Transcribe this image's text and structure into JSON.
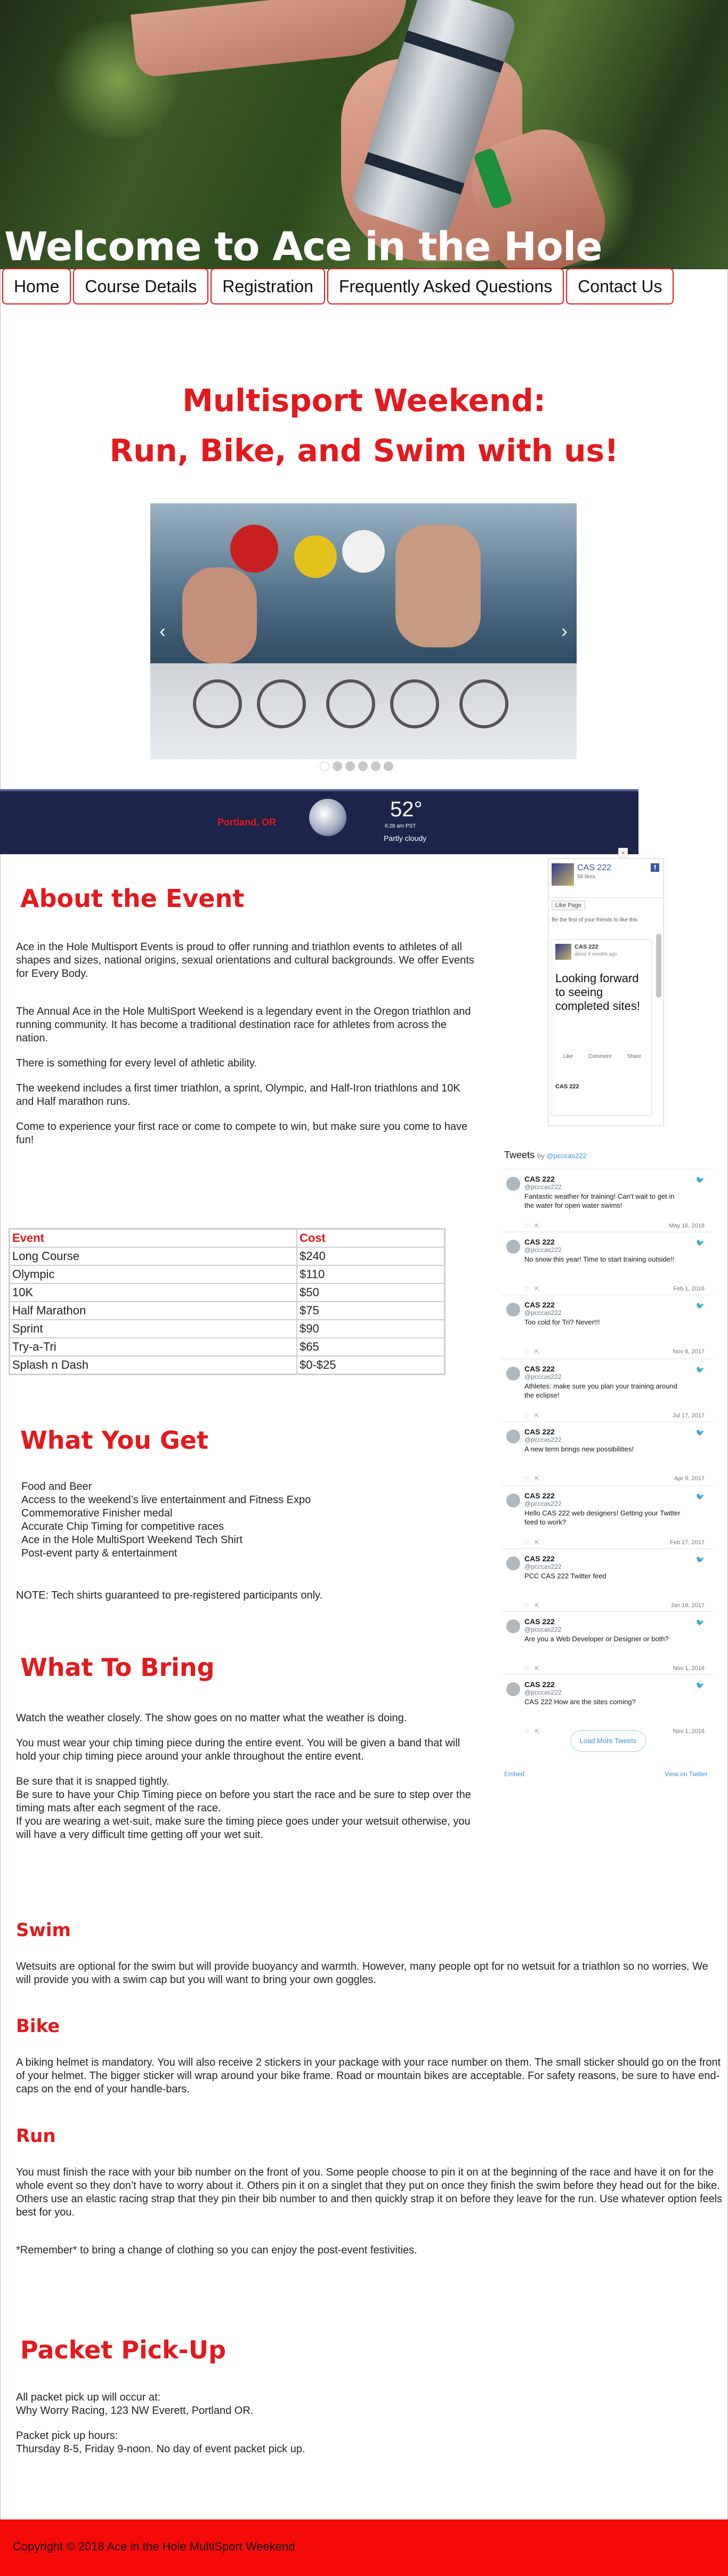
{
  "hero": {
    "title": "Welcome to Ace in the Hole"
  },
  "nav": [
    "Home",
    "Course Details",
    "Registration",
    "Frequently Asked Questions",
    "Contact Us"
  ],
  "tagline": {
    "line1": "Multisport Weekend:",
    "line2": "Run, Bike, and Swim with us!"
  },
  "carousel": {
    "prev": "‹",
    "next": "›",
    "slide_count": 6,
    "active_slide": 1
  },
  "weather": {
    "city": "Portland, OR",
    "temp": "52°",
    "time": "6:28 am PST",
    "condition": "Partly cloudy"
  },
  "about": {
    "heading": "About the Event",
    "paragraphs": [
      "Ace in the Hole Multisport Events is proud to offer running and triathlon events to athletes of all shapes and sizes, national origins, sexual orientations and cultural backgrounds. We offer Events for Every Body.",
      "The Annual Ace in the Hole MultiSport Weekend is a legendary event in the Oregon triathlon and running community. It has become a traditional destination race for athletes from across the nation.",
      "There is something for every level of athletic ability.",
      "The weekend includes a first timer triathlon, a sprint, Olympic, and Half-Iron triathlons and 10K and Half marathon runs.",
      "Come to experience your first race or come to compete to win, but make sure you come to have fun!"
    ]
  },
  "cost_table": {
    "headers": [
      "Event",
      "Cost"
    ],
    "rows": [
      [
        "Long Course",
        "$240"
      ],
      [
        "Olympic",
        "$110"
      ],
      [
        "10K",
        "$50"
      ],
      [
        "Half Marathon",
        "$75"
      ],
      [
        "Sprint",
        "$90"
      ],
      [
        "Try-a-Tri",
        "$65"
      ],
      [
        "Splash n Dash",
        "$0-$25"
      ]
    ]
  },
  "what_you_get": {
    "heading": "What You Get",
    "items": [
      "Food and Beer",
      "Access to the weekend’s live entertainment and Fitness Expo",
      "Commemorative Finisher medal",
      "Accurate Chip Timing for competitive races",
      "Ace in the Hole MultiSport Weekend Tech Shirt",
      "Post-event party & entertainment"
    ],
    "note": "NOTE: Tech shirts guaranteed to pre-registered participants only."
  },
  "what_to_bring": {
    "heading": "What To Bring",
    "p1": "Watch the weather closely. The show goes on no matter what the weather is doing.",
    "p2": "You must wear your chip timing piece during the entire event. You will be given a band that will hold your chip timing piece around your ankle throughout the entire event.",
    "p3": "Be sure that it is snapped tightly.",
    "p4": "Be sure to have your Chip Timing piece on before you start the race and be sure to step over the timing mats after each segment of the race.",
    "p5": "If you are wearing a wet-suit, make sure the timing piece goes under your wetsuit otherwise, you will have a very difficult time getting off your wet suit."
  },
  "swim": {
    "heading": "Swim",
    "text": "Wetsuits are optional for the swim but will provide buoyancy and warmth. However, many people opt for no wetsuit for a triathlon so no worries. We will provide you with a swim cap but you will want to bring your own goggles."
  },
  "bike": {
    "heading": "Bike",
    "text": "A biking helmet is mandatory. You will also receive 2 stickers in your package with your race number on them. The small sticker should go on the front of your helmet. The bigger sticker will wrap around your bike frame. Road or mountain bikes are acceptable. For safety reasons, be sure to have end-caps on the end of your handle-bars."
  },
  "run": {
    "heading": "Run",
    "text": "You must finish the race with your bib number on the front of you. Some people choose to pin it on at the beginning of the race and have it on for the whole event so they don’t have to worry about it. Others pin it on a singlet that they put on once they finish the swim before they head out for the bike. Others use an elastic racing strap that they pin their bib number to and then quickly strap it on before they leave for the run. Use whatever option feels best for you.",
    "remember": "*Remember* to bring a change of clothing so you can enjoy the post-event festivities."
  },
  "packet": {
    "heading": "Packet Pick-Up",
    "l1": "All packet pick up will occur at:",
    "l2": "Why Worry Racing, 123 NW Everett, Portland OR.",
    "l3": "Packet pick up hours:",
    "l4": "Thursday 8-5, Friday 9-noon. No day of event packet pick up."
  },
  "facebook": {
    "page_name": "CAS 222",
    "likes": "58 likes",
    "like_button": "Like Page",
    "friends_text": "Be the first of your friends to like this",
    "post_author": "CAS 222",
    "post_ago": "about 4 months ago",
    "post_text": "Looking forward to seeing completed sites!",
    "actions": [
      "Like",
      "Comment",
      "Share"
    ],
    "next_author": "CAS 222",
    "close": "×"
  },
  "twitter": {
    "title": "Tweets",
    "by": "by",
    "handle": "@pcccas222",
    "tweets": [
      {
        "name": "CAS 222",
        "handle": "@pcccas222",
        "text": "Fantastic weather for training! Can't wait to get in the water for open water swims!",
        "date": "May 16, 2018"
      },
      {
        "name": "CAS 222",
        "handle": "@pcccas222",
        "text": "No snow this year! Time to start training outside!!",
        "date": "Feb 1, 2018"
      },
      {
        "name": "CAS 222",
        "handle": "@pcccas222",
        "text": "Too cold for Tri? Never!!!",
        "date": "Nov 8, 2017"
      },
      {
        "name": "CAS 222",
        "handle": "@pcccas222",
        "text": "Athletes: make sure you plan your training around the eclipse!",
        "date": "Jul 17, 2017"
      },
      {
        "name": "CAS 222",
        "handle": "@pcccas222",
        "text": "A new term brings new possibilities!",
        "date": "Apr 9, 2017"
      },
      {
        "name": "CAS 222",
        "handle": "@pcccas222",
        "text": "Hello CAS 222 web designers! Getting your Twitter feed to work?",
        "date": "Feb 27, 2017"
      },
      {
        "name": "CAS 222",
        "handle": "@pcccas222",
        "text": "PCC CAS 222 Twitter feed",
        "date": "Jan 18, 2017"
      },
      {
        "name": "CAS 222",
        "handle": "@pcccas222",
        "text": "Are you a Web Developer or Designer or both?",
        "date": "Nov 1, 2016"
      },
      {
        "name": "CAS 222",
        "handle": "@pcccas222",
        "text": "CAS 222 How are the sites coming?",
        "date": "Nov 1, 2016"
      }
    ],
    "load_more": "Load More Tweets",
    "embed": "Embed",
    "view_on": "View on Twitter"
  },
  "footer": {
    "text": "Copyright © 2018 Ace in the Hole MultiSport Weekend"
  },
  "colors": {
    "accent": "#e4191b",
    "footer": "#f50a0a",
    "weather_bg": "#1c2549"
  }
}
